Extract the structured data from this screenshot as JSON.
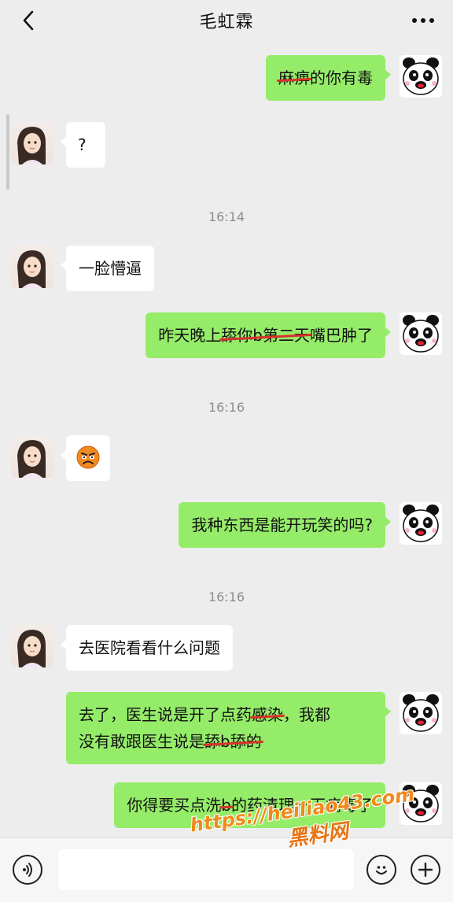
{
  "header": {
    "back_icon": "chevron-left-icon",
    "title": "毛虹霖",
    "more_icon": "ellipsis-icon"
  },
  "messages": [
    {
      "side": "right",
      "parts": [
        {
          "t": "麻痹",
          "s": true
        },
        {
          "t": "的你有毒",
          "s": false
        }
      ]
    },
    {
      "side": "left",
      "text": "?"
    },
    {
      "time": "16:14"
    },
    {
      "side": "left",
      "text": "一脸懵逼"
    },
    {
      "side": "right",
      "parts": [
        {
          "t": "昨天晚上",
          "s": false
        },
        {
          "t": "舔你b第二天",
          "s": true
        },
        {
          "t": "嘴巴肿了",
          "s": false
        }
      ]
    },
    {
      "time": "16:16"
    },
    {
      "side": "left",
      "sticker": "angry-face-emoji"
    },
    {
      "side": "right",
      "text": "我种东西是能开玩笑的吗?"
    },
    {
      "time": "16:16"
    },
    {
      "side": "left",
      "text": "去医院看看什么问题"
    },
    {
      "side": "right",
      "lines": [
        [
          {
            "t": "去了，医生说是开了点药",
            "s": false
          },
          {
            "t": "感染",
            "s": true
          },
          {
            "t": "，我都",
            "s": false
          }
        ],
        [
          {
            "t": "没有敢跟医生说是",
            "s": false
          },
          {
            "t": "舔b舔的",
            "s": true
          }
        ]
      ]
    },
    {
      "side": "right",
      "parts": [
        {
          "t": "你得要买点洗",
          "s": false
        },
        {
          "t": "b",
          "s": true
        },
        {
          "t": "的药清理一下",
          "s": false
        },
        {
          "t": "病毒",
          "s": true
        },
        {
          "t": "了",
          "s": false
        }
      ]
    }
  ],
  "input_bar": {
    "voice_icon": "voice-icon",
    "emoji_icon": "emoji-icon",
    "plus_icon": "plus-icon"
  },
  "watermark": {
    "url": "https://heiliao43.com",
    "name": "黑料网"
  }
}
